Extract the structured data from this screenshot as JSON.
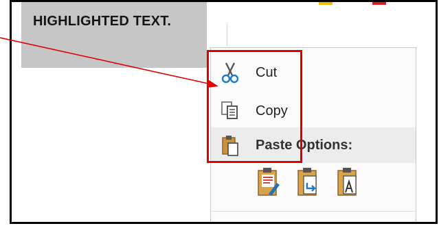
{
  "document": {
    "highlighted_text": "HIGHLIGHTED TEXT."
  },
  "context_menu": {
    "items": [
      {
        "label": "Cut",
        "icon": "scissors-icon"
      },
      {
        "label": "Copy",
        "icon": "copy-icon"
      },
      {
        "label": "Paste Options:",
        "icon": "paste-icon"
      }
    ],
    "paste_options": [
      {
        "icon": "paste-keep-source-formatting-icon"
      },
      {
        "icon": "paste-merge-formatting-icon"
      },
      {
        "icon": "paste-keep-text-only-icon"
      }
    ]
  },
  "annotation": {
    "highlight_color": "#e00000"
  }
}
